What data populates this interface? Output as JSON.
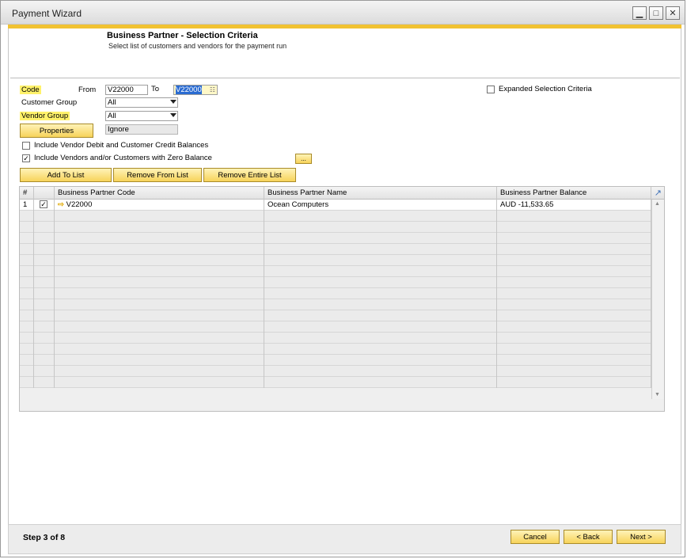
{
  "window": {
    "title": "Payment Wizard",
    "controls": [
      "minimize",
      "maximize",
      "close"
    ]
  },
  "header": {
    "title": "Business Partner - Selection Criteria",
    "subtitle": "Select list of customers and vendors for the payment run"
  },
  "criteria": {
    "code_label": "Code",
    "from_label": "From",
    "from_value": "V22000",
    "to_label": "To",
    "to_value": "V22000",
    "customer_group_label": "Customer Group",
    "customer_group_value": "All",
    "vendor_group_label": "Vendor Group",
    "vendor_group_value": "All",
    "properties_button": "Properties",
    "properties_value": "Ignore",
    "expanded_criteria_label": "Expanded Selection Criteria",
    "expanded_criteria_checked": false,
    "include_debit_label": "Include Vendor Debit and Customer Credit Balances",
    "include_debit_checked": false,
    "include_zero_label": "Include Vendors and/or Customers with Zero Balance",
    "include_zero_checked": true,
    "more_button": "..."
  },
  "list_actions": {
    "add": "Add To List",
    "remove": "Remove From List",
    "remove_all": "Remove Entire List"
  },
  "grid": {
    "columns": [
      "#",
      "",
      "Business Partner Code",
      "Business Partner Name",
      "Business Partner Balance"
    ],
    "rows": [
      {
        "num": "1",
        "checked": true,
        "code": "V22000",
        "name": "Ocean Computers",
        "balance": "AUD -11,533.65"
      }
    ]
  },
  "footer": {
    "step": "Step 3 of 8",
    "cancel": "Cancel",
    "back": "< Back",
    "next": "Next >"
  },
  "colors": {
    "accent": "#f1c232",
    "highlight": "#fff26b",
    "button_top": "#fff3b8",
    "button_bottom": "#f7d35a"
  }
}
